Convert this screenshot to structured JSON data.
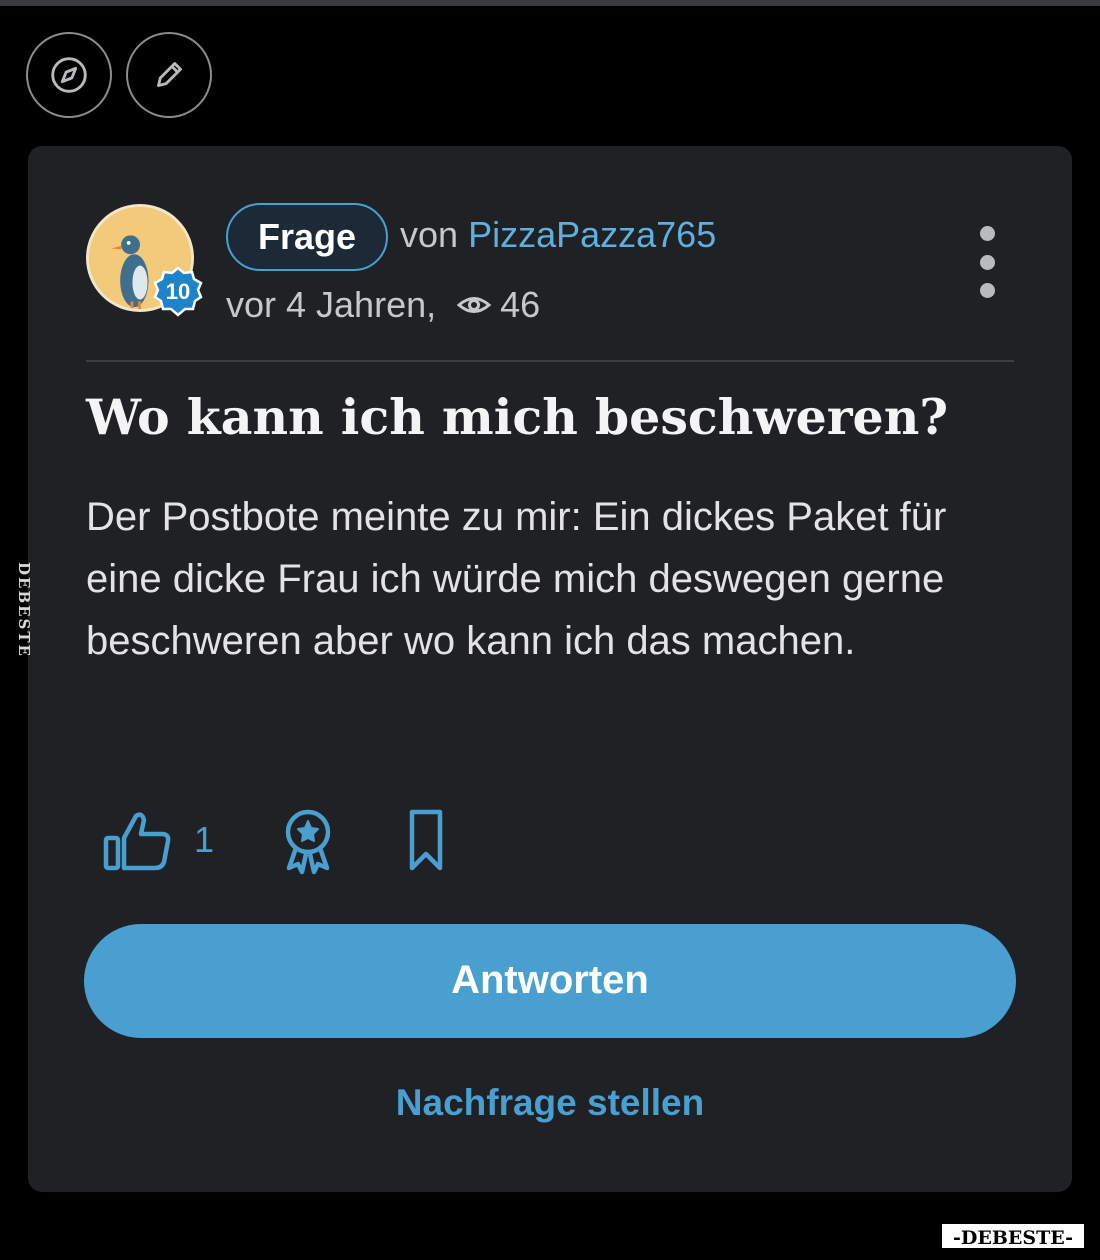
{
  "toolbar": {
    "explore_icon": "compass-icon",
    "write_icon": "pencil-icon"
  },
  "question": {
    "type_label": "Frage",
    "by_prefix": "von",
    "author": "PizzaPazza765",
    "author_level": "10",
    "time": "vor 4 Jahren,",
    "views": "46",
    "title": "Wo kann ich mich beschweren?",
    "body": "Der Postbote meinte zu mir: Ein dickes Paket für eine dicke Frau ich würde mich deswegen gerne beschweren aber wo kann ich das machen."
  },
  "actions": {
    "like_count": "1",
    "answer_label": "Antworten",
    "followup_label": "Nachfrage stellen"
  },
  "watermarks": {
    "side": "DEBESTE",
    "corner": "-DEBESTE-"
  },
  "colors": {
    "accent": "#4a9fd1",
    "card_bg": "#202124",
    "page_bg": "#000000"
  }
}
